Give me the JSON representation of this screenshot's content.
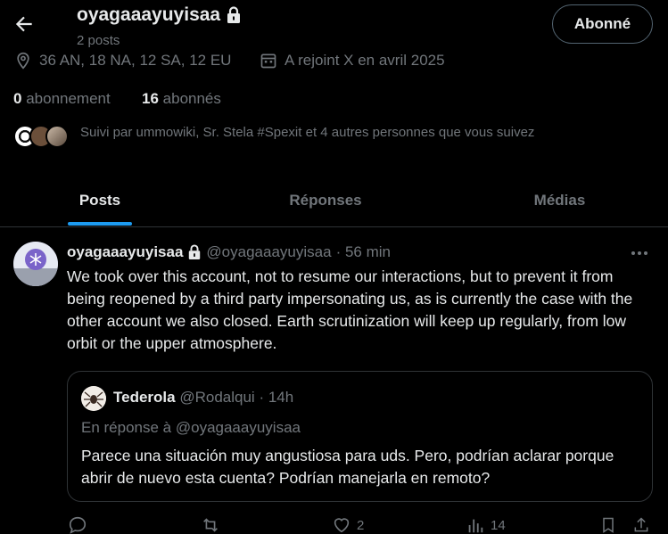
{
  "header": {
    "title": "oyagaaayuyisaa",
    "posts_count": "2 posts",
    "follow_button": "Abonné"
  },
  "profile": {
    "location": "36 AN, 18 NA, 12 SA, 12 EU",
    "joined": "A rejoint X en avril 2025",
    "following_count": "0",
    "following_label": "abonnement",
    "followers_count": "16",
    "followers_label": "abonnés",
    "followed_by": "Suivi par ummowiki, Sr. Stela #Spexit et 4 autres personnes que vous suivez"
  },
  "tabs": [
    {
      "label": "Posts",
      "active": true
    },
    {
      "label": "Réponses",
      "active": false
    },
    {
      "label": "Médias",
      "active": false
    }
  ],
  "tweet": {
    "name": "oyagaaayuyisaa",
    "handle": "@oyagaaayuyisaa",
    "time": "· 56 min",
    "text": "We took over this account, not to resume our interactions, but to prevent it from being reopened by a third party impersonating us, as is currently the case with the other account we also closed. Earth scrutinization will keep up regularly, from low orbit or the upper atmosphere.",
    "quote": {
      "name": "Tederola",
      "handle": "@Rodalqui",
      "time": "· 14h",
      "reply_to": "En réponse à @oyagaaayuyisaa",
      "text": "Parece una situación muy angustiosa para uds. Pero, podrían aclarar porque abrir de nuevo esta cuenta? Podrían manejarla en remoto?"
    },
    "likes": "2",
    "views": "14"
  },
  "colors": {
    "accent": "#1d9bf0",
    "muted": "#71767b",
    "text": "#e7e9ea",
    "border": "#2f3336"
  }
}
